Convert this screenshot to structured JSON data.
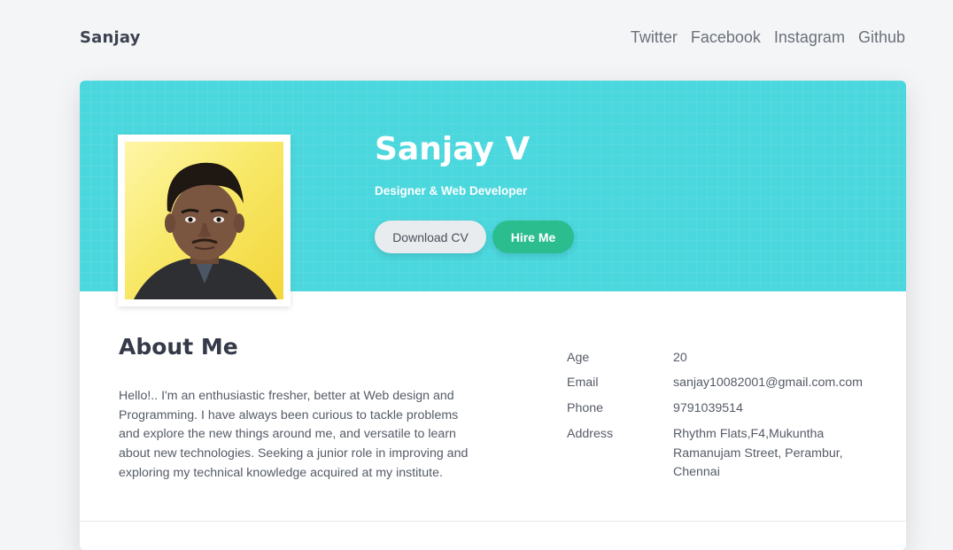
{
  "nav": {
    "brand": "Sanjay",
    "links": [
      "Twitter",
      "Facebook",
      "Instagram",
      "Github"
    ]
  },
  "hero": {
    "name": "Sanjay V",
    "role": "Designer & Web Developer",
    "download_label": "Download CV",
    "hire_label": "Hire Me",
    "banner_color": "#4ad7dd",
    "hire_color": "#2cbd8f"
  },
  "about": {
    "title": "About Me",
    "text": "Hello!.. I'm an enthusiastic fresher, better at Web design and Programming. I have always been curious to tackle problems and explore the new things around me, and versatile to learn about new technologies. Seeking a junior role in improving and exploring my technical knowledge acquired at my institute."
  },
  "info": [
    {
      "label": "Age",
      "value": "20"
    },
    {
      "label": "Email",
      "value": "sanjay10082001@gmail.com.com"
    },
    {
      "label": "Phone",
      "value": "9791039514"
    },
    {
      "label": "Address",
      "value": "Rhythm Flats,F4,Mukuntha Ramanujam Street, Perambur, Chennai"
    }
  ]
}
